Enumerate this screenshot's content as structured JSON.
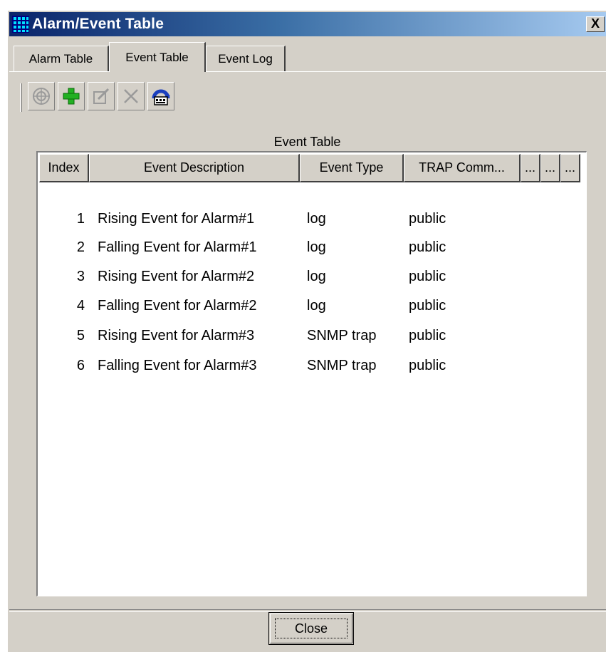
{
  "window": {
    "title": "Alarm/Event Table",
    "close_glyph": "X",
    "app_icon": "grid-app-icon",
    "titlebar_colors": [
      "#0a246a",
      "#a6caf0"
    ]
  },
  "tabs": [
    {
      "label": "Alarm Table",
      "active": false
    },
    {
      "label": "Event Table",
      "active": true
    },
    {
      "label": "Event Log",
      "active": false
    }
  ],
  "toolbar": {
    "buttons": [
      {
        "icon": "target-icon",
        "enabled": false
      },
      {
        "icon": "add-plus-icon",
        "enabled": true
      },
      {
        "icon": "edit-icon",
        "enabled": false
      },
      {
        "icon": "delete-x-icon",
        "enabled": false
      },
      {
        "icon": "refresh-agent-icon",
        "enabled": true
      }
    ]
  },
  "table": {
    "caption": "Event Table",
    "columns": [
      "Index",
      "Event Description",
      "Event Type",
      "TRAP Comm...",
      "...",
      "...",
      "..."
    ],
    "rows": [
      {
        "index": "1",
        "description": "Rising Event for Alarm#1",
        "type": "log",
        "trap": "public"
      },
      {
        "index": "2",
        "description": "Falling Event for Alarm#1",
        "type": "log",
        "trap": "public"
      },
      {
        "index": "3",
        "description": "Rising Event for Alarm#2",
        "type": "log",
        "trap": "public"
      },
      {
        "index": "4",
        "description": "Falling Event for Alarm#2",
        "type": "log",
        "trap": "public"
      },
      {
        "index": "5",
        "description": "Rising Event for Alarm#3",
        "type": "SNMP trap",
        "trap": "public"
      },
      {
        "index": "6",
        "description": "Falling Event for Alarm#3",
        "type": "SNMP trap",
        "trap": "public"
      }
    ]
  },
  "footer": {
    "close_label": "Close"
  },
  "colors": {
    "accent_green": "#22b022",
    "accent_blue": "#1a3fbf",
    "face": "#d4d0c8"
  }
}
